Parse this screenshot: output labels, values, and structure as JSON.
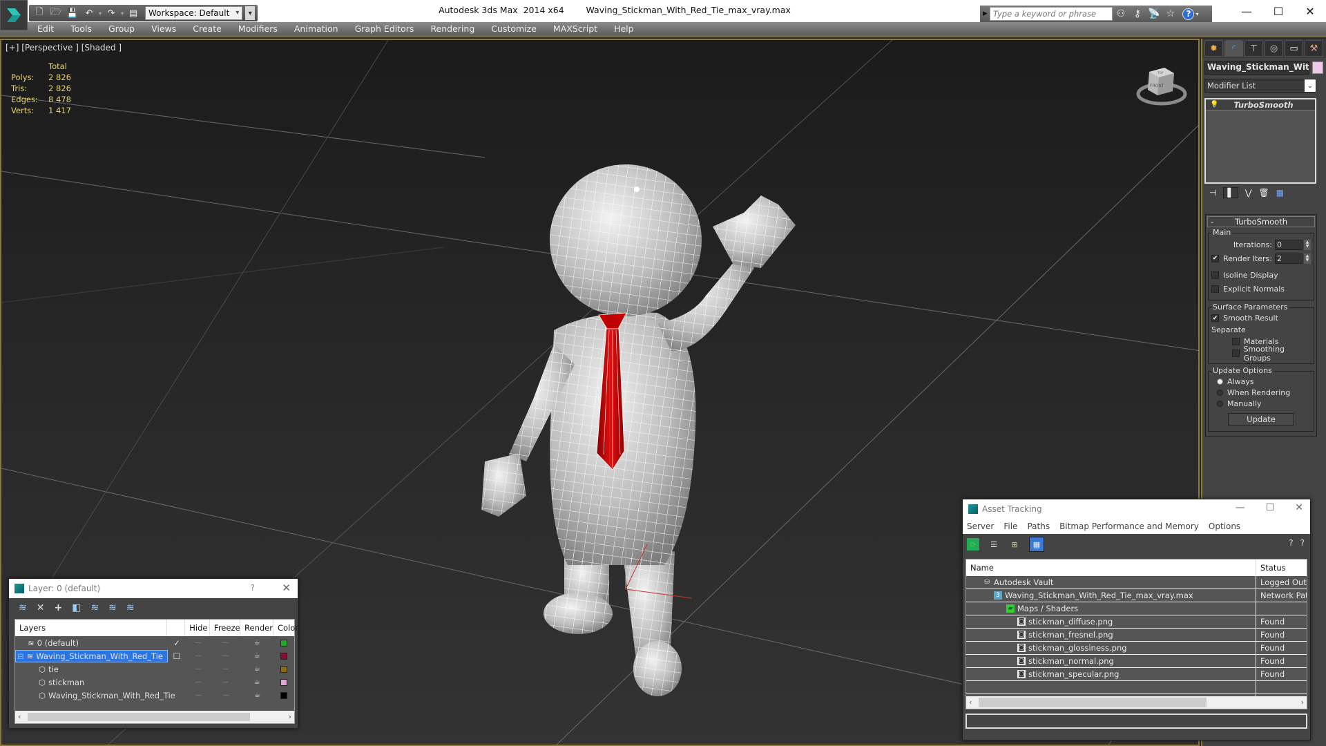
{
  "titlebar": {
    "app_title": "Autodesk 3ds Max  2014 x64",
    "file_name": "Waving_Stickman_With_Red_Tie_max_vray.max",
    "workspace_label": "Workspace: Default",
    "search_placeholder": "Type a keyword or phrase",
    "quick_access": [
      "new-file",
      "open-file",
      "save-file",
      "undo",
      "redo",
      "project-folder"
    ]
  },
  "menubar": {
    "items": [
      "Edit",
      "Tools",
      "Group",
      "Views",
      "Create",
      "Modifiers",
      "Animation",
      "Graph Editors",
      "Rendering",
      "Customize",
      "MAXScript",
      "Help"
    ]
  },
  "viewport": {
    "label": "[+] [Perspective ] [Shaded ]",
    "stats": {
      "header": "Total",
      "rows": [
        {
          "label": "Polys:",
          "value": "2 826"
        },
        {
          "label": "Tris:",
          "value": "2 826"
        },
        {
          "label": "Edges:",
          "value": "8 478"
        },
        {
          "label": "Verts:",
          "value": "1 417"
        }
      ]
    },
    "viewcube_face": "FRONT",
    "viewcube_top": "TOP"
  },
  "command_panel": {
    "tabs": [
      "create",
      "modify",
      "hierarchy",
      "motion",
      "display",
      "utilities"
    ],
    "active_tab": "modify",
    "object_name": "Waving_Stickman_With_",
    "object_color": "#efc9e6",
    "modifier_list_label": "Modifier List",
    "stack_items": [
      "TurboSmooth"
    ],
    "rollout": {
      "title": "TurboSmooth",
      "collapse_glyph": "-",
      "main_group": "Main",
      "iterations_label": "Iterations:",
      "iterations_value": "0",
      "render_iters_label": "Render Iters:",
      "render_iters_value": "2",
      "render_iters_checked": true,
      "isoline_label": "Isoline Display",
      "isoline_checked": false,
      "explicit_normals_label": "Explicit Normals",
      "explicit_normals_checked": false,
      "surface_group": "Surface Parameters",
      "smooth_result_label": "Smooth Result",
      "smooth_result_checked": true,
      "separate_label": "Separate",
      "materials_label": "Materials",
      "materials_checked": false,
      "smoothing_groups_label": "Smoothing Groups",
      "smoothing_groups_checked": false,
      "update_group": "Update Options",
      "update_options": [
        "Always",
        "When Rendering",
        "Manually"
      ],
      "update_selected": "Always",
      "update_button": "Update"
    }
  },
  "layer_dialog": {
    "title": "Layer: 0 (default)",
    "help": "?",
    "columns": [
      "Layers",
      "",
      "Hide",
      "Freeze",
      "Render",
      "Color"
    ],
    "rows": [
      {
        "name": "0 (default)",
        "type": "layer",
        "indent": 1,
        "current": "✓",
        "color": "#1faa2a",
        "selected": false
      },
      {
        "name": "Waving_Stickman_With_Red_Tie",
        "type": "layer",
        "indent": 0,
        "current": "☐",
        "color": "#8a0a3a",
        "selected": true,
        "expander": "⊟"
      },
      {
        "name": "tie",
        "type": "object",
        "indent": 2,
        "current": "",
        "color": "#8a6a0a",
        "selected": false
      },
      {
        "name": "stickman",
        "type": "object",
        "indent": 2,
        "current": "",
        "color": "#e2a6d6",
        "selected": false
      },
      {
        "name": "Waving_Stickman_With_Red_Tie",
        "type": "object",
        "indent": 2,
        "current": "",
        "color": "#000000",
        "selected": false
      }
    ]
  },
  "asset_dialog": {
    "title": "Asset Tracking",
    "menu": [
      "Server",
      "File",
      "Paths",
      "Bitmap Performance and Memory",
      "Options"
    ],
    "columns": [
      "Name",
      "Status"
    ],
    "rows": [
      {
        "name": "Autodesk Vault",
        "status": "Logged Out .",
        "indent": 1,
        "icon": "vault"
      },
      {
        "name": "Waving_Stickman_With_Red_Tie_max_vray.max",
        "status": "Network Path",
        "indent": 2,
        "icon": "max-file"
      },
      {
        "name": "Maps / Shaders",
        "status": "",
        "indent": 3,
        "icon": "maps-folder"
      },
      {
        "name": "stickman_diffuse.png",
        "status": "Found",
        "indent": 4,
        "icon": "bitmap"
      },
      {
        "name": "stickman_fresnel.png",
        "status": "Found",
        "indent": 4,
        "icon": "bitmap"
      },
      {
        "name": "stickman_glossiness.png",
        "status": "Found",
        "indent": 4,
        "icon": "bitmap"
      },
      {
        "name": "stickman_normal.png",
        "status": "Found",
        "indent": 4,
        "icon": "bitmap"
      },
      {
        "name": "stickman_specular.png",
        "status": "Found",
        "indent": 4,
        "icon": "bitmap"
      },
      {
        "name": "",
        "status": "",
        "indent": 0,
        "icon": ""
      },
      {
        "name": "",
        "status": "",
        "indent": 0,
        "icon": ""
      }
    ]
  }
}
